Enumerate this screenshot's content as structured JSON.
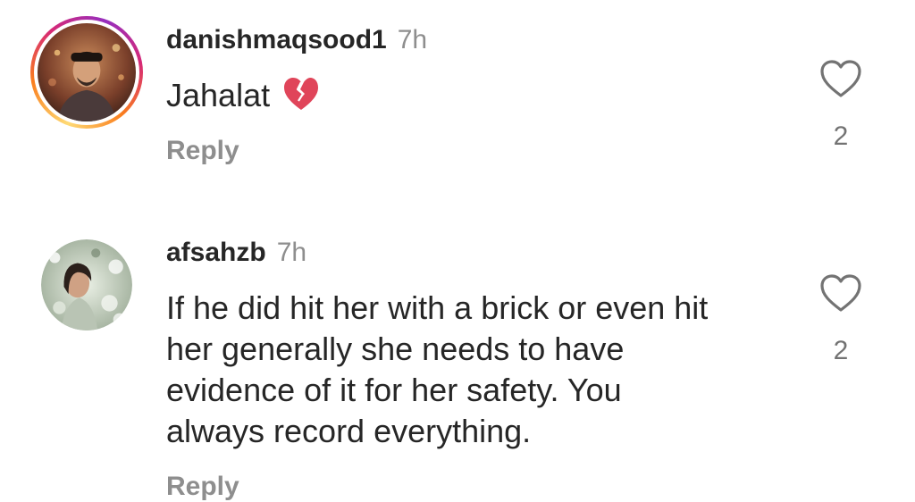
{
  "comments": [
    {
      "username": "danishmaqsood1",
      "time": "7h",
      "text": "Jahalat",
      "emoji": "💔",
      "reply_label": "Reply",
      "like_count": "2",
      "avatar_icon": "male-avatar-photo",
      "has_story_ring": true
    },
    {
      "username": "afsahzb",
      "time": "7h",
      "text_lines": [
        "If he did hit her with a brick or even hit",
        "her generally she needs to have",
        "evidence of it for her safety. You",
        "always record everything."
      ],
      "reply_label": "Reply",
      "like_count": "2",
      "avatar_icon": "female-avatar-photo",
      "has_story_ring": false
    }
  ],
  "colors": {
    "primary_text": "#262626",
    "secondary_text": "#8e8e8e",
    "heart_outline": "#737373"
  }
}
